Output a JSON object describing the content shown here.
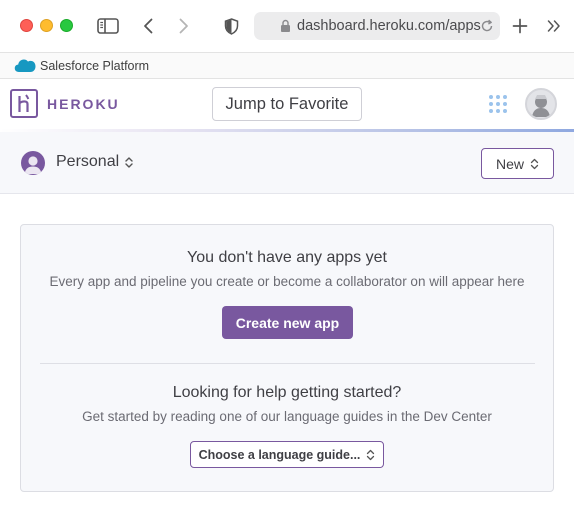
{
  "browser": {
    "url": "dashboard.heroku.com/apps",
    "favorites": [
      {
        "label": "Salesforce Platform"
      }
    ]
  },
  "header": {
    "wordmark": "HEROKU",
    "jump_label": "Jump to Favorite"
  },
  "subheader": {
    "account_label": "Personal",
    "new_label": "New"
  },
  "empty_state": {
    "title": "You don't have any apps yet",
    "description": "Every app and pipeline you create or become a collaborator on will appear here",
    "create_label": "Create new app",
    "help_title": "Looking for help getting started?",
    "help_description": "Get started by reading one of our language guides in the Dev Center",
    "guide_label": "Choose a language guide..."
  },
  "colors": {
    "brand": "#79589f",
    "apps_grid": "#9bc3ec",
    "salesforce_cloud": "#1798c1"
  },
  "icons": {
    "sidebar": "sidebar-icon",
    "back": "chevron-left-icon",
    "forward": "chevron-right-icon",
    "shield": "shield-icon",
    "lock": "lock-icon",
    "reload": "reload-icon",
    "new_tab": "plus-icon",
    "more": "double-chevron-icon",
    "apps": "grid-icon"
  }
}
